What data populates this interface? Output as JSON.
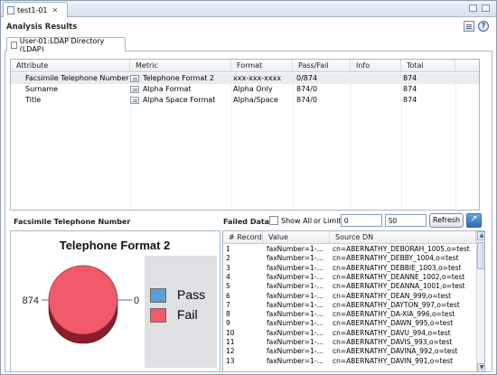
{
  "editor_tab": {
    "label": "test1-01",
    "close": "✕"
  },
  "header": {
    "title": "Analysis Results",
    "help_glyph": "?"
  },
  "sub_tab": {
    "label": "User-01:LDAP Directory (LDAP)"
  },
  "attributes": {
    "columns": [
      "Attribute",
      "Metric",
      "Format",
      "Pass/Fail",
      "Info",
      "Total"
    ],
    "rows": [
      {
        "attribute": "Facsimile Telephone Number",
        "metric": "Telephone Format 2",
        "format": "xxx-xxx-xxxx",
        "passfail": "0/874",
        "info": "",
        "total": "874",
        "selected": true
      },
      {
        "attribute": "Surname",
        "metric": "Alpha Format",
        "format": "Alpha Only",
        "passfail": "874/0",
        "info": "",
        "total": "874",
        "selected": false
      },
      {
        "attribute": "Title",
        "metric": "Alpha Space Format",
        "format": "Alpha/Space",
        "passfail": "874/0",
        "info": "",
        "total": "874",
        "selected": false
      }
    ]
  },
  "chart_section": {
    "title": "Facsimile Telephone Number"
  },
  "chart_data": {
    "type": "pie",
    "title": "Telephone Format 2",
    "categories": [
      "Pass",
      "Fail"
    ],
    "values": [
      0,
      874
    ],
    "colors": [
      "#5b9fd8",
      "#f05a6a"
    ],
    "labels": {
      "left": "874",
      "right": "0"
    },
    "legend_position": "right"
  },
  "failed_section": {
    "title": "Failed Data",
    "show_all_label": "Show All",
    "or_limit_label": "or Limit",
    "offset_value": "0",
    "limit_value": "50",
    "refresh_label": "Refresh",
    "columns": [
      "# Record",
      "Value",
      "Source DN"
    ],
    "rows": [
      [
        "1",
        "faxNumber=1-...",
        "cn=ABERNATHY_DEBORAH_1005,o=test"
      ],
      [
        "2",
        "faxNumber=1-...",
        "cn=ABERNATHY_DEBBY_1004,o=test"
      ],
      [
        "3",
        "faxNumber=1-...",
        "cn=ABERNATHY_DEBBIE_1003,o=test"
      ],
      [
        "4",
        "faxNumber=1-...",
        "cn=ABERNATHY_DEANNE_1002,o=test"
      ],
      [
        "5",
        "faxNumber=1-...",
        "cn=ABERNATHY_DEANNA_1001,o=test"
      ],
      [
        "6",
        "faxNumber=1-...",
        "cn=ABERNATHY_DEAN_999,o=test"
      ],
      [
        "7",
        "faxNumber=1-...",
        "cn=ABERNATHY_DAYTON_997,o=test"
      ],
      [
        "8",
        "faxNumber=1-...",
        "cn=ABERNATHY_DA-XIA_996,o=test"
      ],
      [
        "9",
        "faxNumber=1-...",
        "cn=ABERNATHY_DAWN_995,o=test"
      ],
      [
        "10",
        "faxNumber=1-...",
        "cn=ABERNATHY_DAVU_994,o=test"
      ],
      [
        "11",
        "faxNumber=1-...",
        "cn=ABERNATHY_DAVIS_993,o=test"
      ],
      [
        "12",
        "faxNumber=1-...",
        "cn=ABERNATHY_DAVINA_992,o=test"
      ],
      [
        "13",
        "faxNumber=1-...",
        "cn=ABERNATHY_DAVIN_991,o=test"
      ]
    ]
  }
}
